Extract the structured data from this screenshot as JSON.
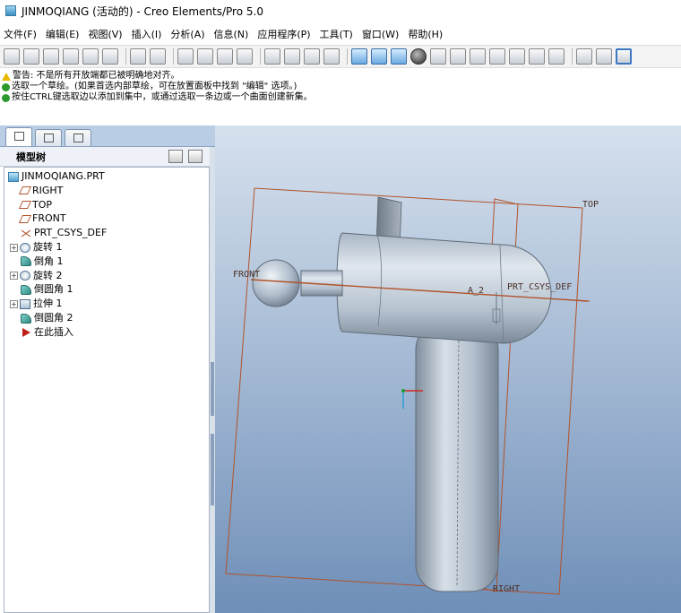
{
  "window": {
    "title": "JINMOQIANG (活动的) - Creo Elements/Pro 5.0"
  },
  "menubar": {
    "items": [
      "文件(F)",
      "编辑(E)",
      "视图(V)",
      "插入(I)",
      "分析(A)",
      "信息(N)",
      "应用程序(P)",
      "工具(T)",
      "窗口(W)",
      "帮助(H)"
    ]
  },
  "toolbar": {
    "icons": [
      "new-file-icon",
      "open-file-icon",
      "save-icon",
      "print-icon",
      "print-preview-icon",
      "email-icon",
      "undo-icon",
      "redo-icon",
      "cut-icon",
      "copy-icon",
      "paste-icon",
      "paste-special-icon",
      "regenerate-icon",
      "regenerate-manager-icon",
      "find-icon",
      "select-box-icon",
      "repaint-icon",
      "spin-center-icon",
      "orient-icon",
      "appearance-icon",
      "zoom-in-icon",
      "zoom-out-icon",
      "refit-icon",
      "reorient-icon",
      "saved-views-icon",
      "layers-icon",
      "view-manager-icon",
      "shading-icon",
      "hidden-line-icon",
      "no-hidden-icon"
    ]
  },
  "messages": {
    "lines": [
      {
        "type": "warning",
        "icon": "warning-icon",
        "text": "警告: 不是所有开放端都已被明确地对齐。"
      },
      {
        "type": "prompt",
        "icon": "arrow-right-icon",
        "text": "选取一个草绘。(如果首选内部草绘，可在放置面板中找到 \"编辑\" 选项。)"
      },
      {
        "type": "prompt",
        "icon": "arrow-right-icon",
        "text": "按住CTRL键选取边以添加到集中，或通过选取一条边或一个曲面创建新集。"
      }
    ]
  },
  "navigator": {
    "tabs": [
      {
        "name": "model-tree-tab",
        "icon": "tree-icon"
      },
      {
        "name": "folder-browser-tab",
        "icon": "folder-icon"
      },
      {
        "name": "favorites-tab",
        "icon": "star-folder-icon"
      }
    ],
    "header": "模型树"
  },
  "tree": {
    "items": [
      {
        "label": "JINMOQIANG.PRT",
        "icon": "part-icon",
        "level": 0,
        "expander": false
      },
      {
        "label": "RIGHT",
        "icon": "datum-plane-icon",
        "level": 1,
        "expander": false
      },
      {
        "label": "TOP",
        "icon": "datum-plane-icon",
        "level": 1,
        "expander": false
      },
      {
        "label": "FRONT",
        "icon": "datum-plane-icon",
        "level": 1,
        "expander": false
      },
      {
        "label": "PRT_CSYS_DEF",
        "icon": "coordinate-system-icon",
        "level": 1,
        "expander": false
      },
      {
        "label": "旋转 1",
        "icon": "revolve-icon",
        "level": 1,
        "expander": true
      },
      {
        "label": "倒角 1",
        "icon": "chamfer-icon",
        "level": 1,
        "expander": false
      },
      {
        "label": "旋转 2",
        "icon": "revolve-icon",
        "level": 1,
        "expander": true
      },
      {
        "label": "倒圆角 1",
        "icon": "round-icon",
        "level": 1,
        "expander": false
      },
      {
        "label": "拉伸 1",
        "icon": "extrude-icon",
        "level": 1,
        "expander": true
      },
      {
        "label": "倒圆角 2",
        "icon": "round-icon",
        "level": 1,
        "expander": false
      },
      {
        "label": "在此插入",
        "icon": "insert-here-icon",
        "level": 1,
        "expander": false
      }
    ]
  },
  "viewport": {
    "labels": {
      "top": "TOP",
      "front": "FRONT",
      "right": "RIGHT",
      "axis": "A_2",
      "csys": "PRT_CSYS_DEF"
    },
    "colors": {
      "bg_top": "#d6e1ee",
      "bg_bottom": "#6f8fb8",
      "datum": "#b2532a",
      "body": "#b9c6d4"
    }
  }
}
